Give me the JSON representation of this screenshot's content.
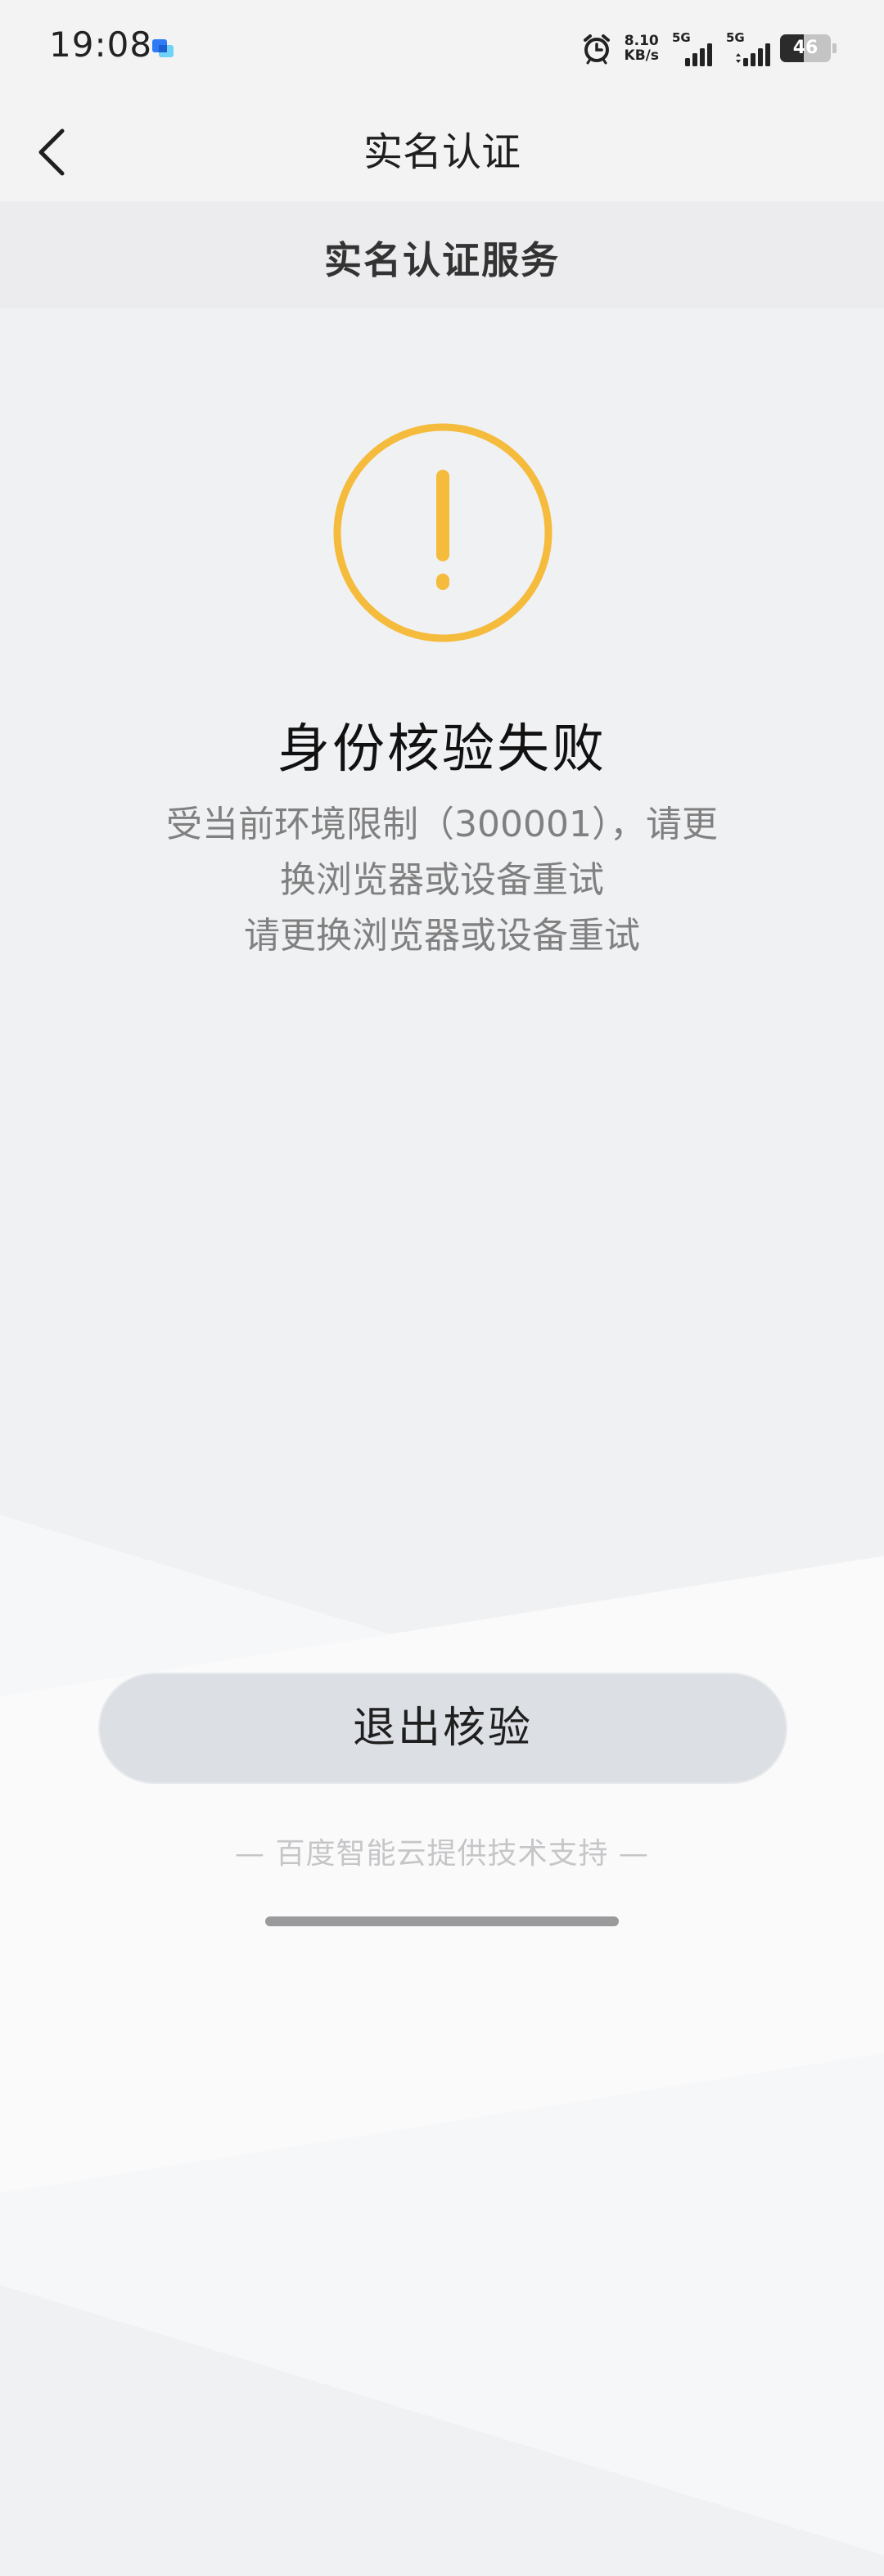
{
  "status_bar": {
    "time": "19:08",
    "net_speed_value": "8.10",
    "net_speed_unit": "KB/s",
    "sim1_label": "5G",
    "sim2_label": "5G",
    "battery_level": "46",
    "icons": [
      "app-notification-icon",
      "alarm-icon",
      "signal-icon",
      "signal-icon",
      "battery-icon"
    ]
  },
  "nav": {
    "back_icon": "chevron-left-icon",
    "title": "实名认证"
  },
  "service": {
    "title": "实名认证服务"
  },
  "result": {
    "icon": "warning-circle-icon",
    "icon_color": "#F5BB3C",
    "title": "身份核验失败",
    "desc_line1": "受当前环境限制（300001），请更",
    "desc_line2": "换浏览器或设备重试",
    "desc_line3": "请更换浏览器或设备重试"
  },
  "actions": {
    "exit_label": "退出核验"
  },
  "footer": {
    "credit": "— 百度智能云提供技术支持 —"
  }
}
